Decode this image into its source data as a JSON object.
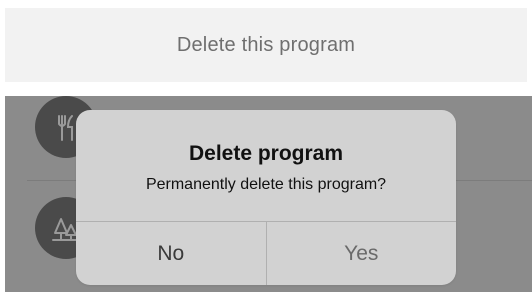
{
  "header": {
    "delete_link": "Delete this program"
  },
  "list": {
    "items": [
      {
        "icon": "fork-knife-icon"
      },
      {
        "icon": "tree-icon"
      }
    ]
  },
  "dialog": {
    "title": "Delete program",
    "message": "Permanently delete this program?",
    "no_label": "No",
    "yes_label": "Yes"
  },
  "colors": {
    "overlay": "#8b8b8b",
    "dialog_bg": "#d2d2d2",
    "icon_circle": "#4a4a4a"
  }
}
